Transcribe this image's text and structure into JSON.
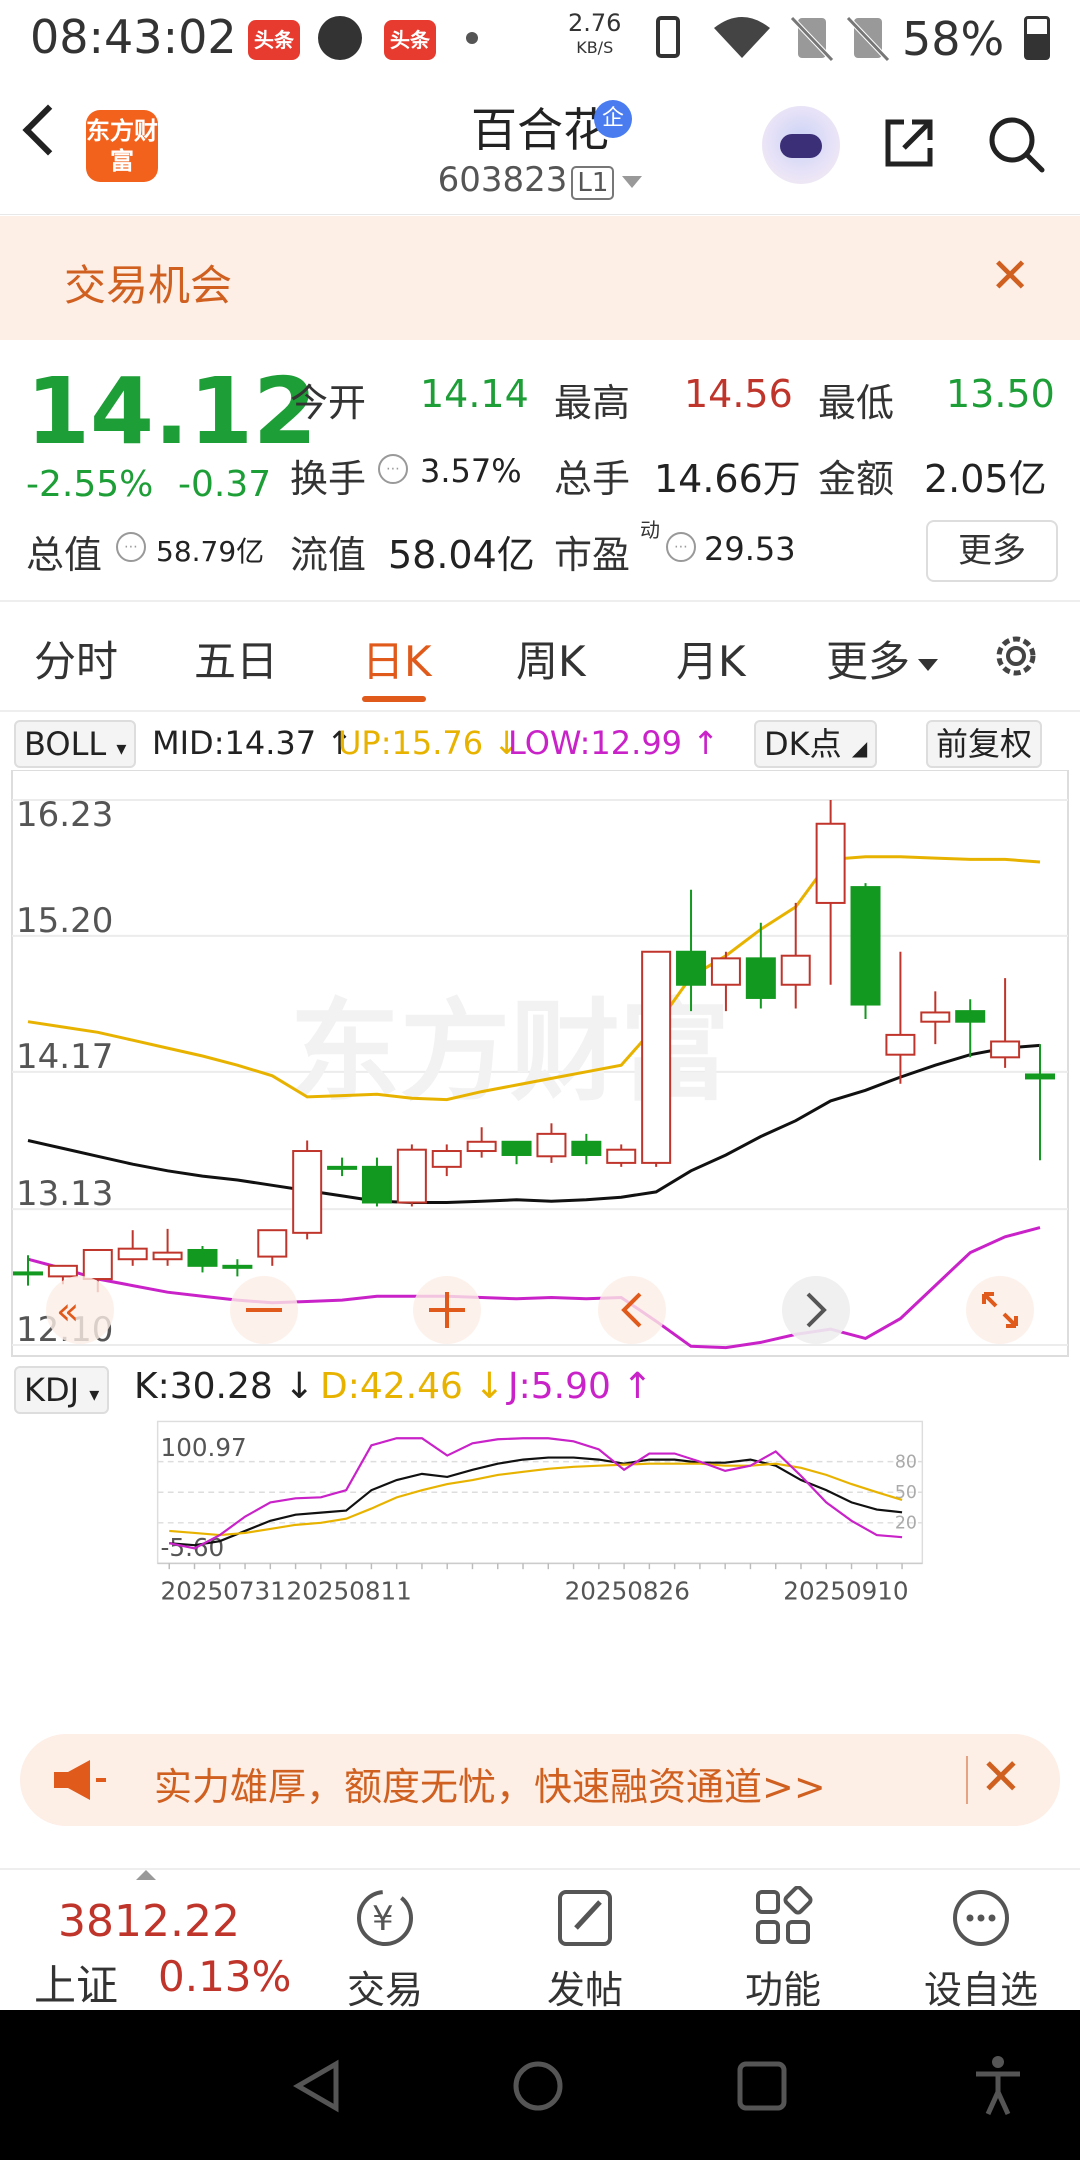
{
  "status_bar": {
    "time": "08:43:02",
    "badge1": "头条",
    "badge2": "头条",
    "net_speed_value": "2.76",
    "net_speed_unit": "KB/S",
    "battery": "58%"
  },
  "header": {
    "logo_text": "东方财富",
    "stock_name": "百合花",
    "corp_badge": "企",
    "stock_code": "603823",
    "level_badge": "L1"
  },
  "banner": {
    "text": "交易机会"
  },
  "quote": {
    "price": "14.12",
    "change_pct": "-2.55%",
    "change": "-0.37",
    "open_label": "今开",
    "open": "14.14",
    "high_label": "最高",
    "high": "14.56",
    "low_label": "最低",
    "low": "13.50",
    "turnover_label": "换手",
    "turnover": "3.57%",
    "volume_label": "总手",
    "volume": "14.66万",
    "amount_label": "金额",
    "amount": "2.05亿",
    "mktcap_label": "总值",
    "mktcap": "58.79亿",
    "float_label": "流值",
    "float": "58.04亿",
    "pe_label": "市盈",
    "pe_sup": "动",
    "pe": "29.53",
    "more": "更多"
  },
  "tabs": [
    "分时",
    "五日",
    "日K",
    "周K",
    "月K",
    "更多"
  ],
  "active_tab": "日K",
  "boll": {
    "name": "BOLL",
    "mid": "MID:14.37 ↑",
    "up": "UP:15.76 ↓",
    "low": "LOW:12.99 ↑",
    "dk": "DK点",
    "adjust": "前复权"
  },
  "kdj": {
    "name": "KDJ",
    "k": "K:30.28 ↓",
    "d": "D:42.46 ↓",
    "j": "J:5.90 ↑"
  },
  "colors": {
    "up": "#c0352b",
    "down": "#12991f",
    "mid": "#111111",
    "upper": "#e8b300",
    "lower": "#c822c8",
    "accent": "#e05a1b"
  },
  "chart_data": [
    {
      "type": "candlestick",
      "title": "",
      "y_ticks": [
        "16.23",
        "15.20",
        "14.17",
        "13.13",
        "12.10"
      ],
      "ylim": [
        12.1,
        16.23
      ],
      "candles": [
        {
          "o": 12.65,
          "h": 12.78,
          "l": 12.55,
          "c": 12.65
        },
        {
          "o": 12.62,
          "h": 12.7,
          "l": 12.56,
          "c": 12.7
        },
        {
          "o": 12.6,
          "h": 12.82,
          "l": 12.5,
          "c": 12.82
        },
        {
          "o": 12.75,
          "h": 12.97,
          "l": 12.7,
          "c": 12.83
        },
        {
          "o": 12.75,
          "h": 12.98,
          "l": 12.7,
          "c": 12.8
        },
        {
          "o": 12.82,
          "h": 12.85,
          "l": 12.65,
          "c": 12.7
        },
        {
          "o": 12.7,
          "h": 12.75,
          "l": 12.62,
          "c": 12.7
        },
        {
          "o": 12.77,
          "h": 12.97,
          "l": 12.7,
          "c": 12.97
        },
        {
          "o": 12.95,
          "h": 13.65,
          "l": 12.9,
          "c": 13.57
        },
        {
          "o": 13.45,
          "h": 13.52,
          "l": 13.38,
          "c": 13.45
        },
        {
          "o": 13.45,
          "h": 13.52,
          "l": 13.15,
          "c": 13.18
        },
        {
          "o": 13.18,
          "h": 13.62,
          "l": 13.15,
          "c": 13.58
        },
        {
          "o": 13.45,
          "h": 13.62,
          "l": 13.38,
          "c": 13.57
        },
        {
          "o": 13.57,
          "h": 13.75,
          "l": 13.52,
          "c": 13.64
        },
        {
          "o": 13.64,
          "h": 13.58,
          "l": 13.47,
          "c": 13.54
        },
        {
          "o": 13.53,
          "h": 13.78,
          "l": 13.48,
          "c": 13.7
        },
        {
          "o": 13.64,
          "h": 13.7,
          "l": 13.47,
          "c": 13.54
        },
        {
          "o": 13.48,
          "h": 13.62,
          "l": 13.45,
          "c": 13.58
        },
        {
          "o": 13.48,
          "h": 15.08,
          "l": 13.45,
          "c": 15.08
        },
        {
          "o": 15.08,
          "h": 15.55,
          "l": 14.63,
          "c": 14.83
        },
        {
          "o": 14.83,
          "h": 15.08,
          "l": 14.63,
          "c": 15.03
        },
        {
          "o": 15.03,
          "h": 15.3,
          "l": 14.65,
          "c": 14.73
        },
        {
          "o": 14.83,
          "h": 15.45,
          "l": 14.65,
          "c": 15.05
        },
        {
          "o": 15.45,
          "h": 16.23,
          "l": 14.83,
          "c": 16.05
        },
        {
          "o": 15.57,
          "h": 15.6,
          "l": 14.57,
          "c": 14.68
        },
        {
          "o": 14.3,
          "h": 15.08,
          "l": 14.08,
          "c": 14.45
        },
        {
          "o": 14.55,
          "h": 14.78,
          "l": 14.38,
          "c": 14.62
        },
        {
          "o": 14.63,
          "h": 14.72,
          "l": 14.28,
          "c": 14.55
        },
        {
          "o": 14.28,
          "h": 14.88,
          "l": 14.2,
          "c": 14.4
        },
        {
          "o": 14.15,
          "h": 14.38,
          "l": 13.5,
          "c": 14.12
        }
      ],
      "mid": [
        13.65,
        13.59,
        13.53,
        13.47,
        13.42,
        13.38,
        13.35,
        13.31,
        13.27,
        13.23,
        13.19,
        13.18,
        13.18,
        13.19,
        13.2,
        13.19,
        13.2,
        13.22,
        13.26,
        13.42,
        13.54,
        13.68,
        13.8,
        13.95,
        14.03,
        14.13,
        14.22,
        14.3,
        14.35,
        14.37
      ],
      "upper": [
        14.55,
        14.51,
        14.47,
        14.41,
        14.35,
        14.29,
        14.22,
        14.14,
        13.98,
        13.99,
        14.0,
        13.97,
        13.96,
        14.02,
        14.07,
        14.12,
        14.17,
        14.22,
        14.52,
        14.89,
        15.05,
        15.25,
        15.42,
        15.78,
        15.8,
        15.8,
        15.79,
        15.78,
        15.78,
        15.76
      ],
      "lower": [
        12.75,
        12.68,
        12.6,
        12.55,
        12.5,
        12.47,
        12.44,
        12.42,
        12.43,
        12.44,
        12.47,
        12.47,
        12.47,
        12.46,
        12.45,
        12.46,
        12.45,
        12.46,
        12.28,
        12.09,
        12.08,
        12.12,
        12.18,
        12.22,
        12.15,
        12.3,
        12.55,
        12.8,
        12.92,
        12.99
      ]
    },
    {
      "type": "line",
      "title": "",
      "y_ticks": [
        "100.97",
        "-5.60"
      ],
      "ylim": [
        -5.6,
        100.97
      ],
      "right_ticks": [
        "80",
        "50",
        "20"
      ],
      "x_tick_labels": [
        "20250731",
        "20250811",
        "20250826",
        "20250910"
      ],
      "series": [
        {
          "name": "K",
          "values": [
            0,
            -2,
            2,
            12,
            22,
            28,
            30,
            32,
            52,
            62,
            68,
            65,
            72,
            78,
            82,
            84,
            84,
            82,
            78,
            82,
            82,
            79,
            79,
            82,
            76,
            62,
            52,
            40,
            33,
            30.28
          ]
        },
        {
          "name": "D",
          "values": [
            12,
            10,
            8,
            10,
            14,
            18,
            20,
            24,
            34,
            45,
            52,
            58,
            62,
            67,
            70,
            73,
            75,
            76,
            77,
            78,
            78,
            78,
            76,
            76,
            78,
            74,
            67,
            58,
            50,
            42.46
          ]
        },
        {
          "name": "J",
          "values": [
            0,
            -5,
            8,
            26,
            40,
            44,
            45,
            52,
            96,
            108,
            108,
            86,
            98,
            102,
            104,
            104,
            100,
            92,
            72,
            88,
            88,
            80,
            71,
            76,
            90,
            66,
            40,
            22,
            8,
            5.9
          ]
        }
      ]
    }
  ],
  "promo": {
    "text": "实力雄厚，额度无忧，快速融资通道>>"
  },
  "bottom_bar": {
    "index_value": "3812.22",
    "index_name": "上证",
    "index_change": "0.13%",
    "items": [
      "交易",
      "发帖",
      "功能",
      "设自选"
    ]
  }
}
